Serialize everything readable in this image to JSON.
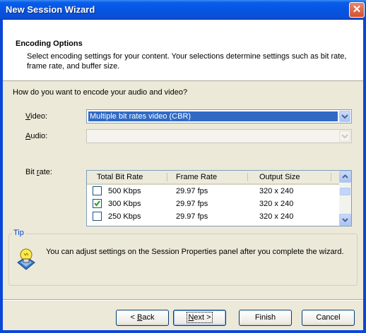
{
  "window": {
    "title": "New Session Wizard",
    "close_glyph": "✕"
  },
  "header": {
    "title": "Encoding Options",
    "description": "Select encoding settings for your content. Your selections determine settings such as bit rate, frame rate, and buffer size."
  },
  "question": "How do you want to encode your audio and video?",
  "video": {
    "label_first": "V",
    "label_rest": "ideo:",
    "value": "Multiple bit rates video (CBR)"
  },
  "audio": {
    "label_first": "A",
    "label_rest": "udio:",
    "value": ""
  },
  "bitrate": {
    "label_first": "Bit ",
    "label_ul": "r",
    "label_rest": "ate:",
    "columns": [
      "Total Bit Rate",
      "Frame Rate",
      "Output Size"
    ],
    "rows": [
      {
        "checked": false,
        "bitrate": "500 Kbps",
        "frame_rate": "29.97 fps",
        "output_size": "320 x 240"
      },
      {
        "checked": true,
        "bitrate": "300 Kbps",
        "frame_rate": "29.97 fps",
        "output_size": "320 x 240"
      },
      {
        "checked": false,
        "bitrate": "250 Kbps",
        "frame_rate": "29.97 fps",
        "output_size": "320 x 240"
      }
    ]
  },
  "tip": {
    "legend": "Tip",
    "text": "You can adjust settings on the Session Properties panel after you complete the wizard.",
    "icon": "lightbulb-tip-icon"
  },
  "buttons": {
    "back_prefix": "< ",
    "back_ul": "B",
    "back_rest": "ack",
    "next_ul": "N",
    "next_rest": "ext >",
    "finish": "Finish",
    "cancel": "Cancel"
  },
  "colors": {
    "title_bar": "#0a5ee8",
    "selection": "#316ac5",
    "dialog_bg": "#ece9d8",
    "tip_legend": "#0046d5"
  }
}
